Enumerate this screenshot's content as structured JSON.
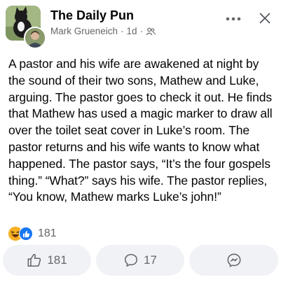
{
  "post": {
    "page_name": "The Daily Pun",
    "author": "Mark Grueneich",
    "separator": "·",
    "time": "1d",
    "separator2": "·",
    "privacy_icon": "friends-icon",
    "text": "A pastor and his wife are awakened at night by the sound of their two sons, Mathew and Luke, arguing. The pastor goes to check it out. He finds that Mathew has used a magic marker to draw all over the toilet seat cover in Luke’s room. The pastor returns and his wife wants to know what happened. The pastor says, “It’s the four gospels thing.” “What?” says his wife. The pastor replies, “You know, Mathew marks Luke’s john!”"
  },
  "reactions": {
    "icons": [
      "haha-reaction-icon",
      "like-reaction-icon"
    ],
    "count": "181"
  },
  "actions": {
    "like_count": "181",
    "comment_count": "17",
    "share_icon": "messenger-icon"
  },
  "colors": {
    "meta_gray": "#65676b",
    "button_bg": "#f0f2f5",
    "like_blue": "#1877f2",
    "haha_yellow": "#f7b125"
  }
}
